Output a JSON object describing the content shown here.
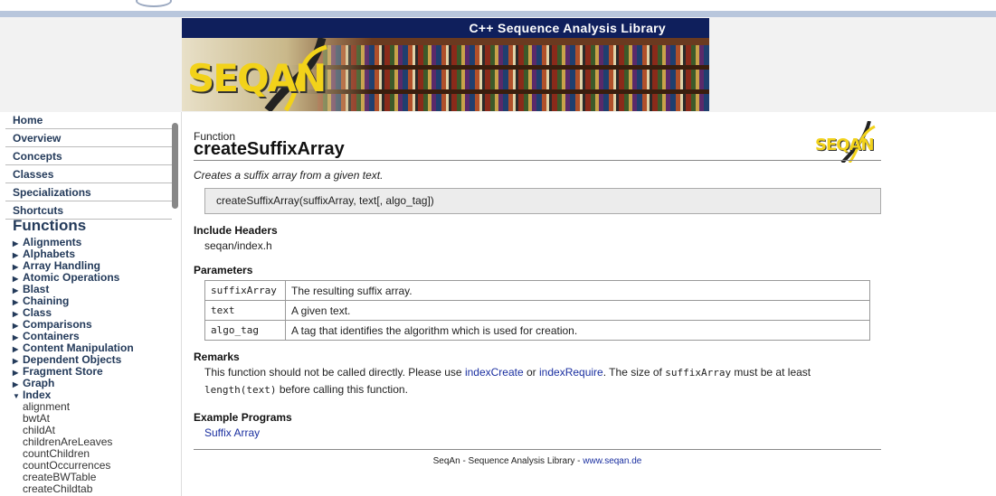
{
  "banner": {
    "tagline": "C++ Sequence Analysis Library",
    "logo_text": "SEQAN"
  },
  "sidebar": {
    "nav": [
      "Home",
      "Overview",
      "Concepts",
      "Classes",
      "Specializations",
      "Shortcuts"
    ],
    "functions_title": "Functions",
    "categories": [
      "Alignments",
      "Alphabets",
      "Array Handling",
      "Atomic Operations",
      "Blast",
      "Chaining",
      "Class",
      "Comparisons",
      "Containers",
      "Content Manipulation",
      "Dependent Objects",
      "Fragment Store",
      "Graph"
    ],
    "expanded_category": "Index",
    "index_items": [
      "alignment",
      "bwtAt",
      "childAt",
      "childrenAreLeaves",
      "countChildren",
      "countOccurrences",
      "createBWTable",
      "createChildtab"
    ]
  },
  "main": {
    "kind": "Function",
    "title": "createSuffixArray",
    "logo_text": "SEQAN",
    "summary": "Creates a suffix array from a given text.",
    "signature": "createSuffixArray(suffixArray, text[, algo_tag])",
    "include_heading": "Include Headers",
    "include_file": "seqan/index.h",
    "params_heading": "Parameters",
    "params": [
      {
        "name": "suffixArray",
        "desc": "The resulting suffix array."
      },
      {
        "name": "text",
        "desc": "A given text."
      },
      {
        "name": "algo_tag",
        "desc": "A tag that identifies the algorithm which is used for creation."
      }
    ],
    "remarks_heading": "Remarks",
    "remarks": {
      "p1": "This function should not be called directly. Please use ",
      "link1": "indexCreate",
      "p2": " or ",
      "link2": "indexRequire",
      "p3": ". The size of ",
      "code1": "suffixArray",
      "p4": " must be at least",
      "code2": "length(text)",
      "p5": " before calling this function."
    },
    "examples_heading": "Example Programs",
    "example_link": "Suffix Array",
    "footer_text": "SeqAn - Sequence Analysis Library - ",
    "footer_link": "www.seqan.de"
  }
}
